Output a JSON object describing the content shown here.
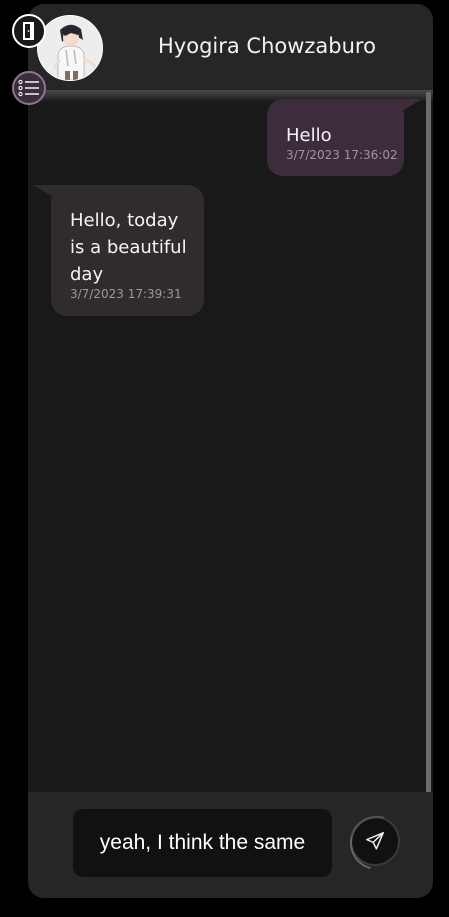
{
  "header": {
    "contact_name": "Hyogira Chowzaburo"
  },
  "messages": [
    {
      "direction": "sent",
      "text": "Hello",
      "timestamp": "3/7/2023 17:36:02"
    },
    {
      "direction": "received",
      "text": "Hello, today is a beautiful day",
      "timestamp": "3/7/2023 17:39:31"
    }
  ],
  "composer": {
    "value": "yeah, I think the same"
  },
  "icons": {
    "exit": "door-exit-icon",
    "menu": "list-menu-icon",
    "send": "paper-plane-icon"
  },
  "colors": {
    "sent_bubble": "#3d2d3c",
    "received_bubble": "#302c2b",
    "chat_background": "#191919",
    "panel_background": "#262626"
  }
}
